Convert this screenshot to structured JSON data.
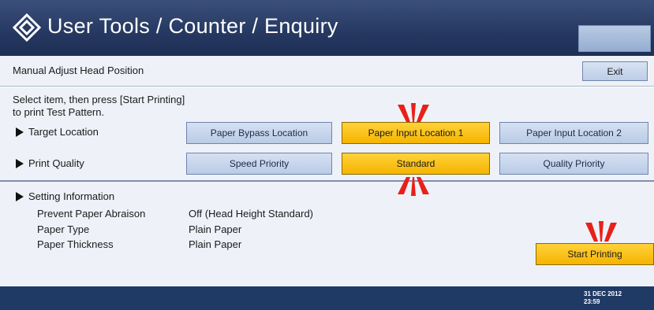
{
  "header": {
    "title": "User Tools / Counter / Enquiry",
    "logo_icon": "diamond-logo-icon"
  },
  "screen_title": "Manual Adjust Head Position",
  "exit_label": "Exit",
  "instruction": {
    "line1": "Select item, then press [Start Printing]",
    "line2": "to print Test Pattern."
  },
  "target_location": {
    "label": "Target Location",
    "options": [
      "Paper Bypass Location",
      "Paper Input Location 1",
      "Paper Input Location 2"
    ],
    "selected": "Paper Input Location 1"
  },
  "print_quality": {
    "label": "Print Quality",
    "options": [
      "Speed Priority",
      "Standard",
      "Quality Priority"
    ],
    "selected": "Standard"
  },
  "setting_info": {
    "heading": "Setting Information",
    "rows": [
      {
        "label": "Prevent Paper Abraison",
        "value": "Off (Head Height Standard)"
      },
      {
        "label": "Paper Type",
        "value": "Plain Paper"
      },
      {
        "label": "Paper Thickness",
        "value": "Plain Paper"
      }
    ]
  },
  "start_label": "Start Printing",
  "footer": {
    "date": "31 DEC 2012",
    "time": "23:59"
  },
  "colors": {
    "header_bg": "#253861",
    "panel_bg": "#eef2f8",
    "button_bg": "#c6d5ec",
    "selected_bg": "#f5b400",
    "footer_bg": "#203a66",
    "marker_red": "#e8201a"
  }
}
